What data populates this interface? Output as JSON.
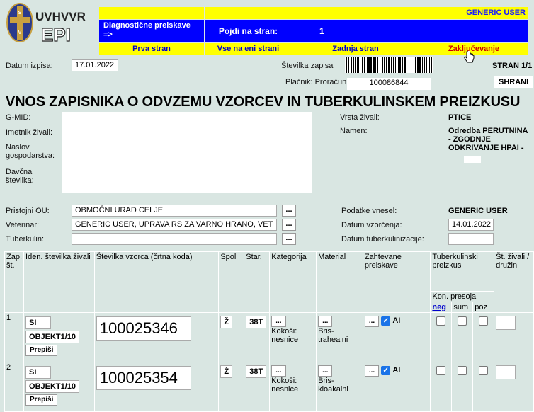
{
  "header": {
    "logo_text": "UVHVVR EPI",
    "user": "GENERIC USER",
    "diagnostic_link": "Diagnostične preiskave =>",
    "goto_label": "Pojdi na stran:",
    "goto_page": "1",
    "first_page": "Prva stran",
    "all_pages": "Vse na eni strani",
    "last_page": "Zadnja stran",
    "close": "Zaključevanje"
  },
  "record": {
    "date_label": "Datum izpisa:",
    "date_value": "17.01.2022",
    "record_number_label": "Številka zapisa",
    "payer_label": "Plačnik: Proračun",
    "barcode_number": "100086844",
    "page_label": "STRAN 1/1",
    "save_label": "SHRANI"
  },
  "title": "VNOS ZAPISNIKA O ODVZEMU VZORCEV IN TUBERKULINSKEM PREIZKUSU",
  "owner": {
    "gmid_label": "G-MID:",
    "owner_label": "Imetnik živali:",
    "address_label": "Naslov gospodarstva:",
    "tax_label": "Davčna številka:"
  },
  "animal": {
    "type_label": "Vrsta živali:",
    "type_value": "PTICE",
    "purpose_label": "Namen:",
    "purpose_value": "Odredba PERUTNINA - ZGODNJE ODKRIVANJE HPAI -"
  },
  "office": {
    "office_label": "Pristojni OU:",
    "office_value": "OBMOČNI URAD CELJE",
    "vet_label": "Veterinar:",
    "vet_value": "GENERIC USER, UPRAVA RS ZA VARNO HRANO, VET",
    "tuberculin_label": "Tuberkulin:",
    "tuberculin_value": "",
    "more_button": "...",
    "entered_by_label": "Podatke vnesel:",
    "entered_by_value": "GENERIC USER",
    "sampling_date_label": "Datum vzorčenja:",
    "sampling_date_value": "14.01.2022",
    "tuberculin_date_label": "Datum tuberkulinizacije:",
    "tuberculin_date_value": ""
  },
  "table": {
    "headers": {
      "zap": "Zap. št.",
      "id": "Iden. številka živali",
      "sample": "Številka vzorca (črtna koda)",
      "sex": "Spol",
      "age": "Star.",
      "category": "Kategorija",
      "material": "Material",
      "tests": "Zahtevane preiskave",
      "tb": "Tuberkulinski preizkus",
      "reading": "Kon. presoja",
      "neg": "neg",
      "sum": "sum",
      "poz": "poz",
      "count": "Št. živali / družin"
    },
    "rows": [
      {
        "zap": "1",
        "country": "SI",
        "object": "OBJEKT1/10",
        "copy": "Prepiši",
        "sample": "100025346",
        "sex": "Ž",
        "age": "38T",
        "cat_btn": "...",
        "category": "Kokoši: nesnice",
        "mat_btn": "...",
        "material": "Bris-trahealni",
        "test_btn": "...",
        "test": "AI"
      },
      {
        "zap": "2",
        "country": "SI",
        "object": "OBJEKT1/10",
        "copy": "Prepiši",
        "sample": "100025354",
        "sex": "Ž",
        "age": "38T",
        "cat_btn": "...",
        "category": "Kokoši: nesnice",
        "mat_btn": "...",
        "material": "Bris-kloakalni",
        "test_btn": "...",
        "test": "AI"
      }
    ]
  }
}
